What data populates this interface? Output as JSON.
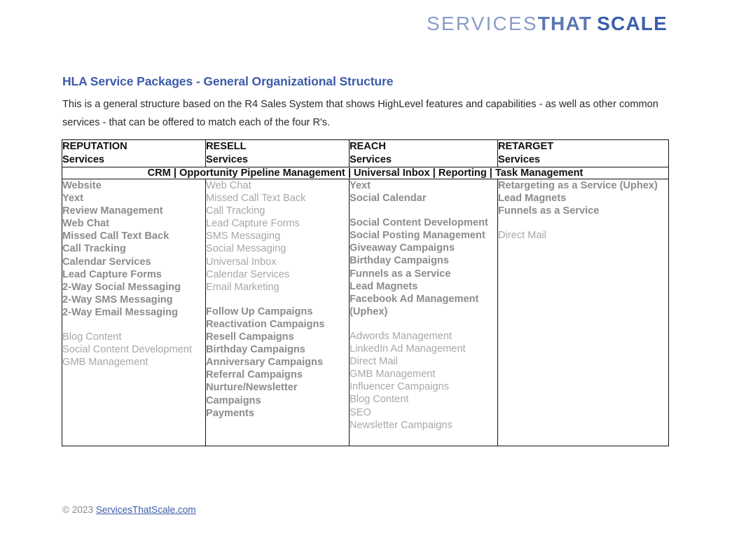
{
  "logo": {
    "part1": "SERVICES",
    "part2": "THAT",
    "part3": "SCALE",
    "color1": "#8a9cc8",
    "color2": "#5b77b5",
    "color3": "#3a5fad"
  },
  "header": {
    "title": "HLA Service Packages - General Organizational Structure",
    "title_color": "#3c5ca8",
    "intro": "This is a general structure based on the R4 Sales System that shows HighLevel features and capabilities - as well as other common services - that can be offered to match each of the four R's."
  },
  "table": {
    "shared_row_label": "CRM | Opportunity Pipeline Management | Universal Inbox | Reporting | Task Management",
    "columns": [
      {
        "heading": "REPUTATION",
        "subheading": "Services",
        "blocks": [
          {
            "emphasis": "strong",
            "items": [
              "Website",
              "Yext",
              "Review Management",
              "Web Chat",
              "Missed Call Text Back",
              "Call Tracking",
              "Calendar Services",
              "Lead Capture Forms",
              "2-Way Social Messaging",
              "2-Way SMS Messaging",
              "2-Way Email Messaging"
            ]
          },
          {
            "emphasis": "light",
            "items": [
              "Blog Content",
              "Social Content Development",
              "GMB Management"
            ]
          }
        ]
      },
      {
        "heading": "RESELL",
        "subheading": "Services",
        "blocks": [
          {
            "emphasis": "light",
            "items": [
              "Web Chat",
              "Missed Call Text Back",
              "Call Tracking",
              "Lead Capture Forms",
              "SMS Messaging",
              "Social Messaging",
              "Universal Inbox",
              "Calendar Services",
              "Email Marketing"
            ]
          },
          {
            "emphasis": "strong",
            "items": [
              "Follow Up Campaigns",
              "Reactivation Campaigns",
              "Resell Campaigns",
              "Birthday Campaigns",
              "Anniversary Campaigns",
              "Referral Campaigns",
              "Nurture/Newsletter Campaigns",
              "Payments"
            ]
          }
        ]
      },
      {
        "heading": "REACH",
        "subheading": "Services",
        "blocks": [
          {
            "emphasis": "strong",
            "items": [
              "Yext",
              "Social Calendar"
            ]
          },
          {
            "emphasis": "strong",
            "items": [
              "Social Content Development",
              "Social Posting Management",
              "Giveaway Campaigns",
              "Birthday Campaigns",
              "Funnels as a Service",
              "Lead Magnets",
              "Facebook Ad Management (Uphex)"
            ]
          },
          {
            "emphasis": "light",
            "items": [
              "Adwords Management",
              "LinkedIn Ad Management",
              "Direct Mail",
              "GMB Management",
              "Influencer Campaigns",
              "Blog Content",
              "SEO",
              "Newsletter Campaigns"
            ]
          }
        ]
      },
      {
        "heading": "RETARGET",
        "subheading": "Services",
        "blocks": [
          {
            "emphasis": "strong",
            "items": [
              "Retargeting as a Service (Uphex)",
              "Lead Magnets",
              "Funnels as a Service"
            ]
          },
          {
            "emphasis": "light",
            "items": [
              "Direct Mail"
            ]
          }
        ]
      }
    ]
  },
  "footer": {
    "copyright": "© 2023 ",
    "link_text": "ServicesThatScale.com"
  }
}
